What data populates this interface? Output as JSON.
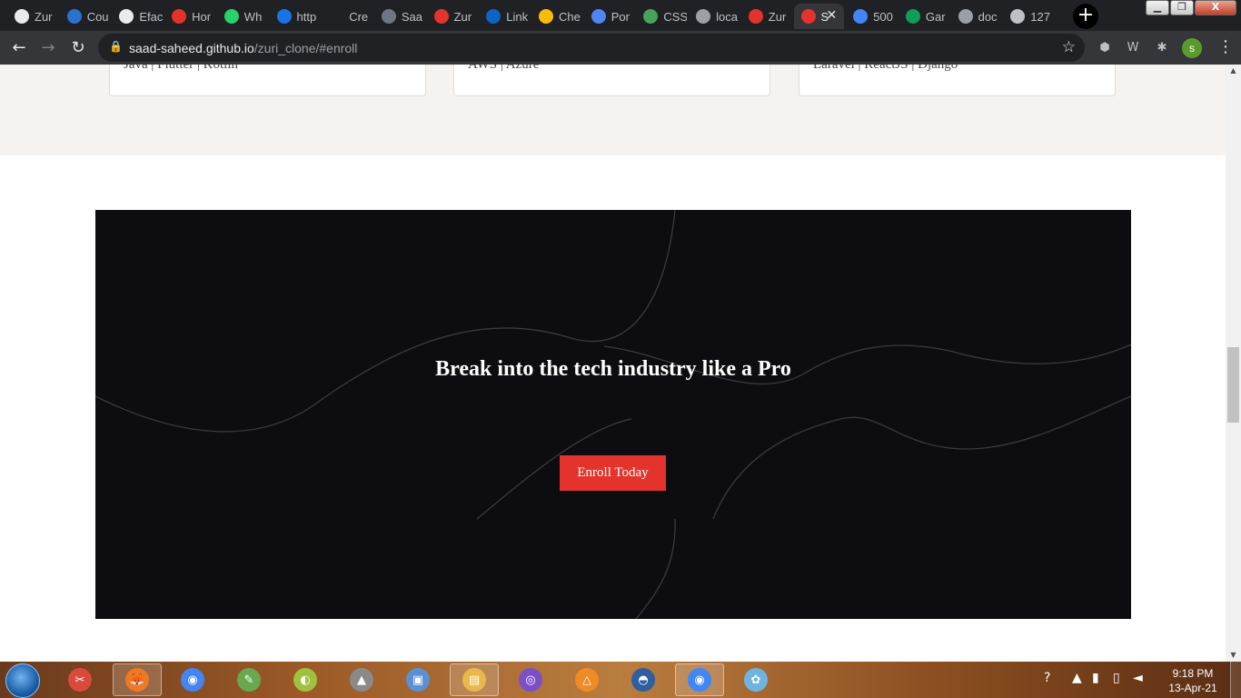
{
  "browser": {
    "tabs": [
      {
        "label": "Zur",
        "icon": "globe-icon",
        "color": "#e8eaed"
      },
      {
        "label": "Cou",
        "icon": "coursera-icon",
        "color": "#2a73cc"
      },
      {
        "label": "Efac",
        "icon": "globe-icon",
        "color": "#e8eaed"
      },
      {
        "label": "Hor",
        "icon": "codepen-icon",
        "color": "#e4332c"
      },
      {
        "label": "Wh",
        "icon": "whatsapp-icon",
        "color": "#25d366"
      },
      {
        "label": "http",
        "icon": "video-icon",
        "color": "#1a73e8"
      },
      {
        "label": "Cre",
        "icon": "blank-icon",
        "color": "#202124"
      },
      {
        "label": "Saa",
        "icon": "github-icon",
        "color": "#6e7681"
      },
      {
        "label": "Zur",
        "icon": "recording-dot-icon",
        "color": "#e4332c"
      },
      {
        "label": "Link",
        "icon": "linkedin-icon",
        "color": "#0a66c2"
      },
      {
        "label": "Che",
        "icon": "gift-icon",
        "color": "#fbbc04"
      },
      {
        "label": "Por",
        "icon": "stripe-icon",
        "color": "#4f86f7"
      },
      {
        "label": "CSS",
        "icon": "chart-icon",
        "color": "#46a35e"
      },
      {
        "label": "loca",
        "icon": "grid-icon",
        "color": "#9aa0a6"
      },
      {
        "label": "Zur",
        "icon": "recording-dot-icon",
        "color": "#e4332c"
      },
      {
        "label": "S",
        "icon": "s-dot-icon",
        "color": "#e4332c",
        "active": true
      },
      {
        "label": "500",
        "icon": "docs-icon",
        "color": "#4285f4"
      },
      {
        "label": "Gar",
        "icon": "sheets-icon",
        "color": "#0f9d58"
      },
      {
        "label": "doc",
        "icon": "list-icon",
        "color": "#9aa0a6"
      },
      {
        "label": "127",
        "icon": "s-dot-icon",
        "color": "#bdc1c6"
      }
    ],
    "url_host": "saad-saheed.github.io",
    "url_path": "/zuri_clone/#enroll",
    "profile_initial": "s",
    "window_controls": {
      "minimize": "▁",
      "maximize": "❐",
      "close": "X"
    }
  },
  "page": {
    "tracks": [
      {
        "text": "Java | Flutter | Kotlin"
      },
      {
        "text": "AWS | Azure"
      },
      {
        "text": "Laravel | ReactJS | Django"
      }
    ],
    "cta": {
      "title": "Break into the tech industry like a Pro",
      "button_label": "Enroll Today",
      "button_color": "#e4332c",
      "background": "#0d0c10"
    }
  },
  "taskbar": {
    "clock_time": "9:18 PM",
    "clock_date": "13-Apr-21",
    "apps": [
      {
        "name": "snipping-tool-icon",
        "glyph": "✂"
      },
      {
        "name": "firefox-icon",
        "glyph": "🦊"
      },
      {
        "name": "chrome-icon",
        "glyph": "◉"
      },
      {
        "name": "tux-paint-icon",
        "glyph": "✎"
      },
      {
        "name": "chameleon-icon",
        "glyph": "◐"
      },
      {
        "name": "rocket-icon",
        "glyph": "▲"
      },
      {
        "name": "virtualbox-icon",
        "glyph": "▣"
      },
      {
        "name": "file-explorer-icon",
        "glyph": "▤"
      },
      {
        "name": "vpn-icon",
        "glyph": "◎"
      },
      {
        "name": "vlc-icon",
        "glyph": "△"
      },
      {
        "name": "emulator-icon",
        "glyph": "◓"
      },
      {
        "name": "chrome-profile-icon",
        "glyph": "◉"
      },
      {
        "name": "paint-icon",
        "glyph": "✿"
      }
    ]
  }
}
